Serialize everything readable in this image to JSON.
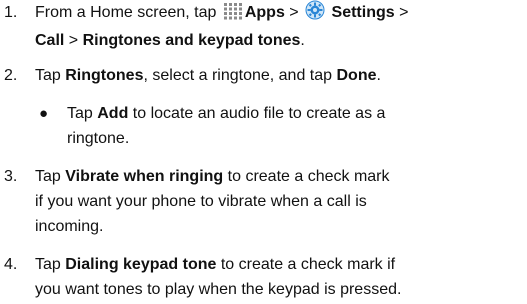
{
  "steps": [
    {
      "number": "1.",
      "parts": {
        "t1": "From a Home screen, tap ",
        "apps": "Apps",
        "sep1": " > ",
        "settings": "Settings",
        "sep2": " >",
        "call": "Call",
        "sep3": " > ",
        "ringtones_keypad": "Ringtones and keypad tones",
        "end": "."
      },
      "icons": [
        "apps-grid-icon",
        "settings-gear-icon"
      ]
    },
    {
      "number": "2.",
      "parts": {
        "t1": "Tap ",
        "ringtones": "Ringtones",
        "t2": ", select a ringtone, and tap ",
        "done": "Done",
        "end": "."
      },
      "bullet": {
        "symbol": "●",
        "t1": "Tap ",
        "add": "Add",
        "t2": " to locate an audio file to create as a",
        "t3": "ringtone."
      }
    },
    {
      "number": "3.",
      "parts": {
        "t1": "Tap ",
        "vibrate": "Vibrate when ringing",
        "t2": " to create a check mark",
        "line2": "if you want your phone to vibrate when a call is",
        "line3": "incoming."
      }
    },
    {
      "number": "4.",
      "parts": {
        "t1": "Tap ",
        "dialing": "Dialing keypad tone",
        "t2": " to create a check mark if",
        "line2": "you want tones to play when the keypad is pressed."
      }
    }
  ],
  "colors": {
    "text": "#111111",
    "icon_grid": "#8a8a8a",
    "icon_gear_blue": "#2a86d6",
    "icon_gear_light": "#cfe6f8"
  }
}
